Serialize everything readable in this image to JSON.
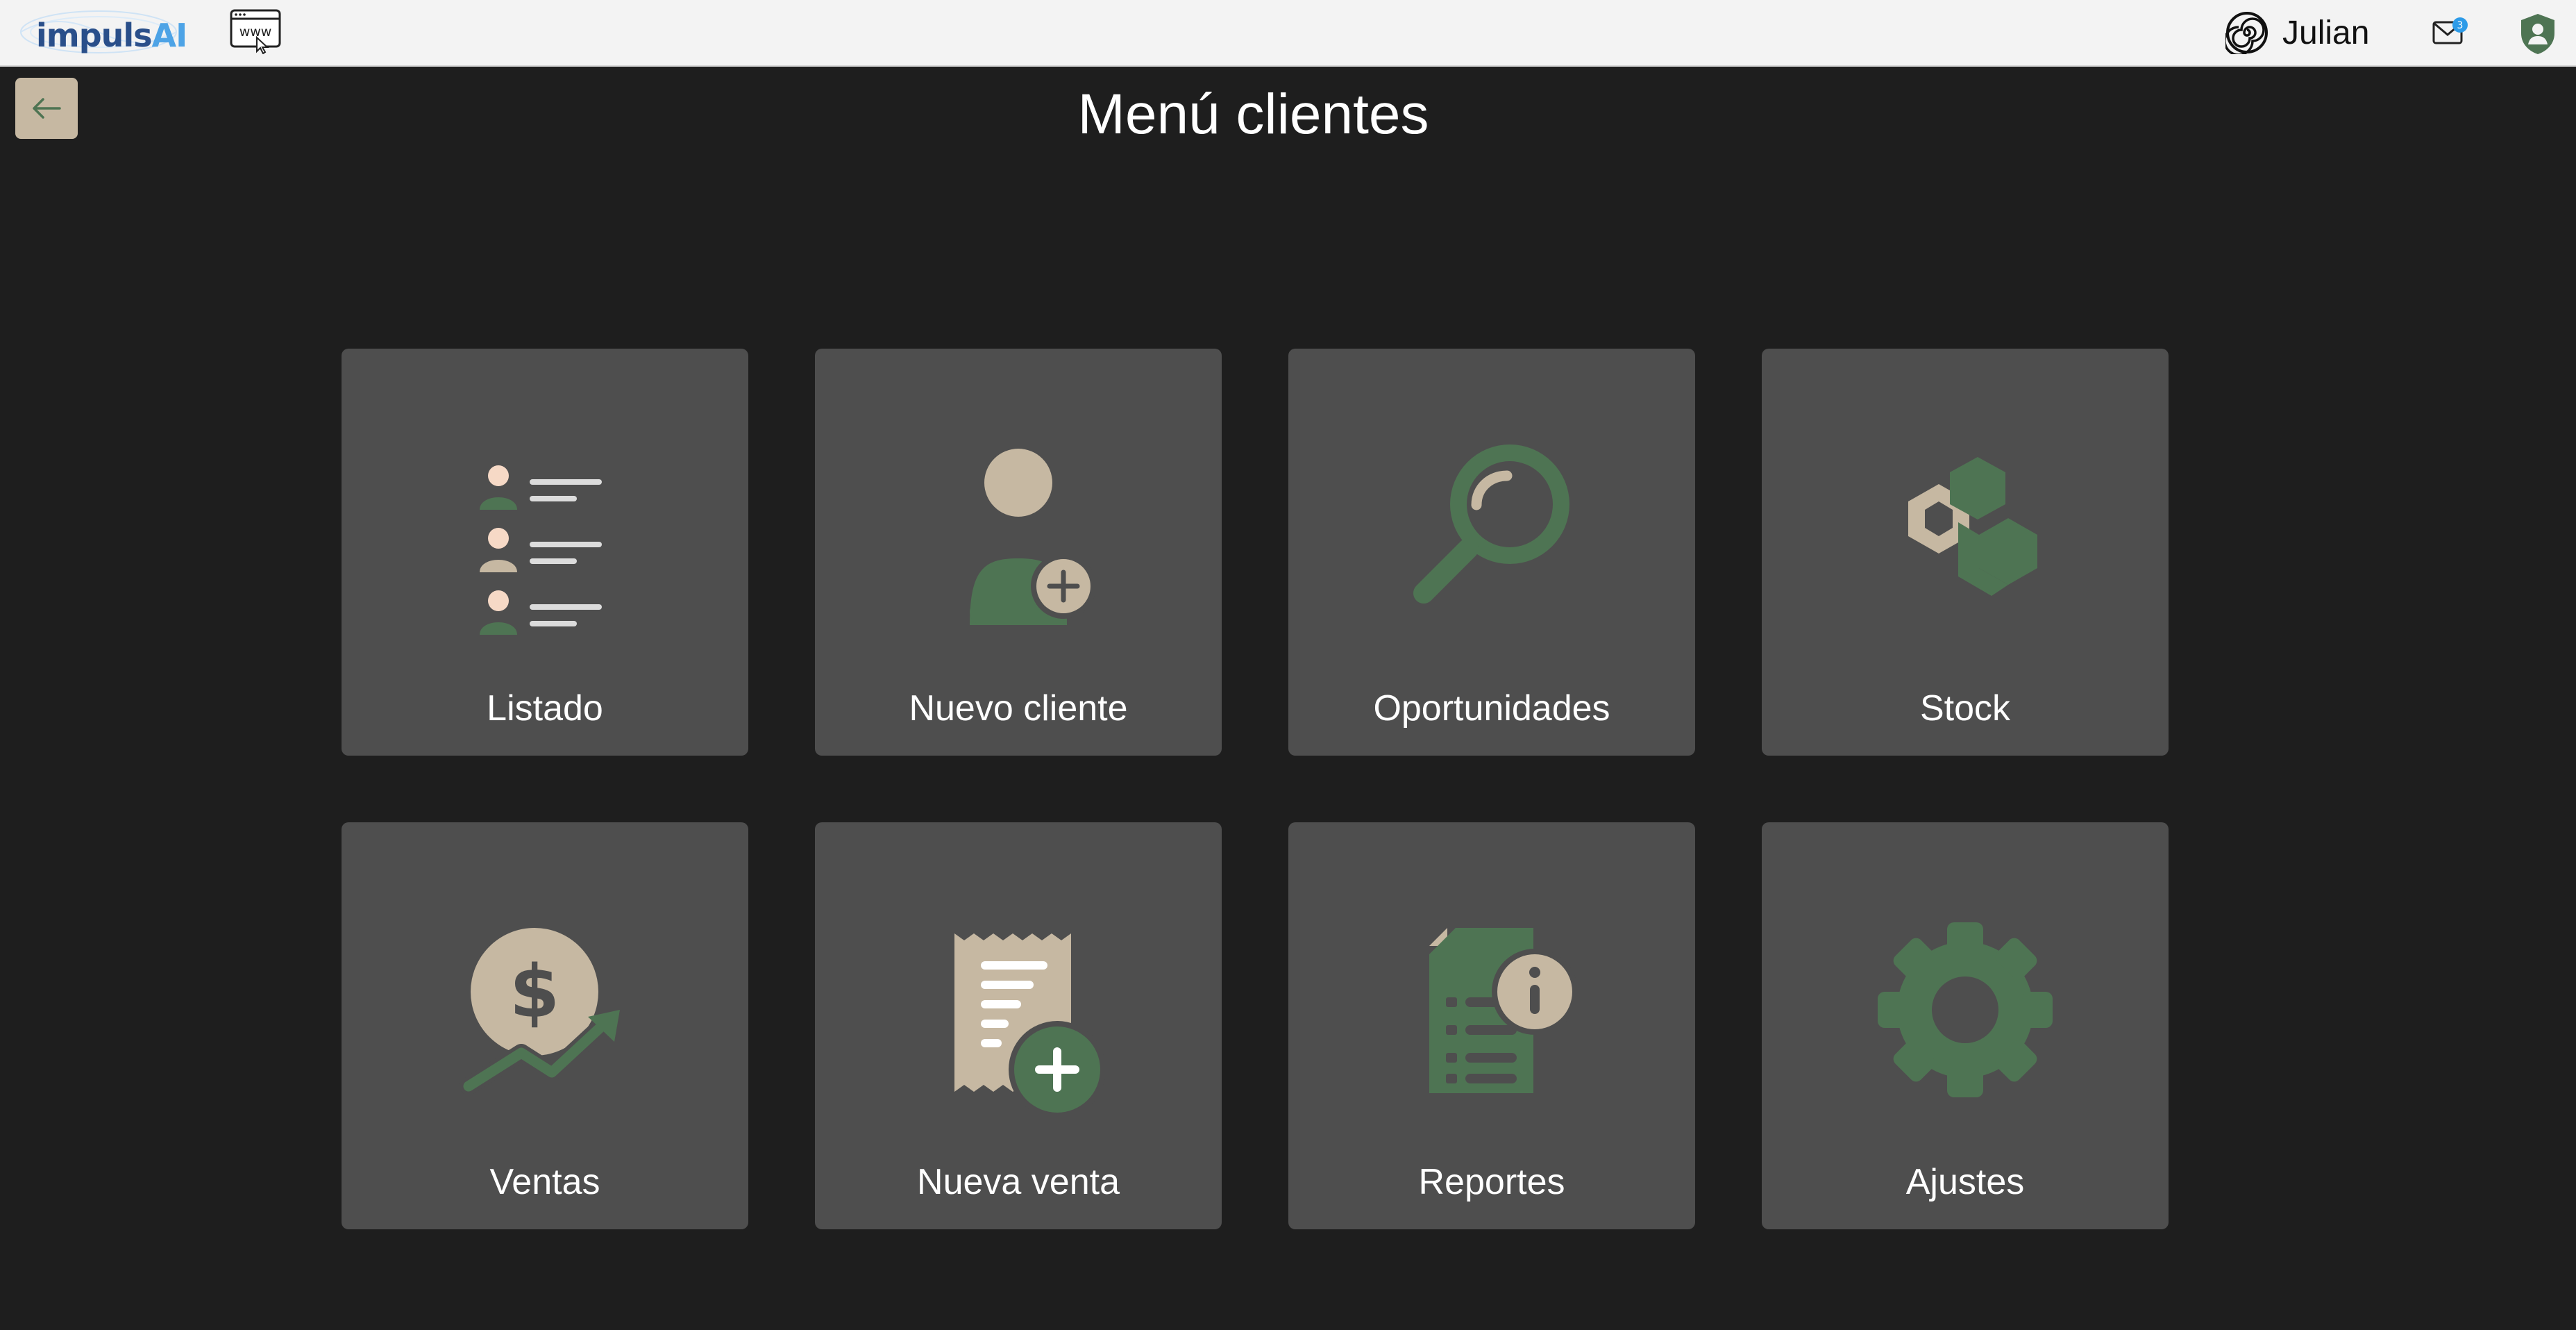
{
  "header": {
    "logo": {
      "text_main": "impuls",
      "text_accent": "AI",
      "icon": "impulsai-logo"
    },
    "www_icon": "www-browser-icon",
    "user": {
      "name": "Julian",
      "icon": "spiral-avatar-icon"
    },
    "mail": {
      "icon": "mail-icon",
      "badge": "3"
    },
    "shield_icon": "shield-user-icon"
  },
  "back_button": {
    "icon": "arrow-left-icon"
  },
  "page": {
    "title": "Menú clientes"
  },
  "tiles": [
    {
      "label": "Listado",
      "icon": "client-list-icon"
    },
    {
      "label": "Nuevo cliente",
      "icon": "add-user-icon"
    },
    {
      "label": "Oportunidades",
      "icon": "magnifier-icon"
    },
    {
      "label": "Stock",
      "icon": "boxes-icon"
    },
    {
      "label": "Ventas",
      "icon": "sales-growth-icon"
    },
    {
      "label": "Nueva venta",
      "icon": "new-receipt-icon"
    },
    {
      "label": "Reportes",
      "icon": "report-info-icon"
    },
    {
      "label": "Ajustes",
      "icon": "gear-icon"
    }
  ],
  "colors": {
    "background": "#1e1e1e",
    "topbar": "#f3f3f3",
    "tile": "#4e4e4e",
    "green": "#4e7453",
    "beige": "#c6b8a2",
    "accent_blue": "#2d9be8"
  }
}
